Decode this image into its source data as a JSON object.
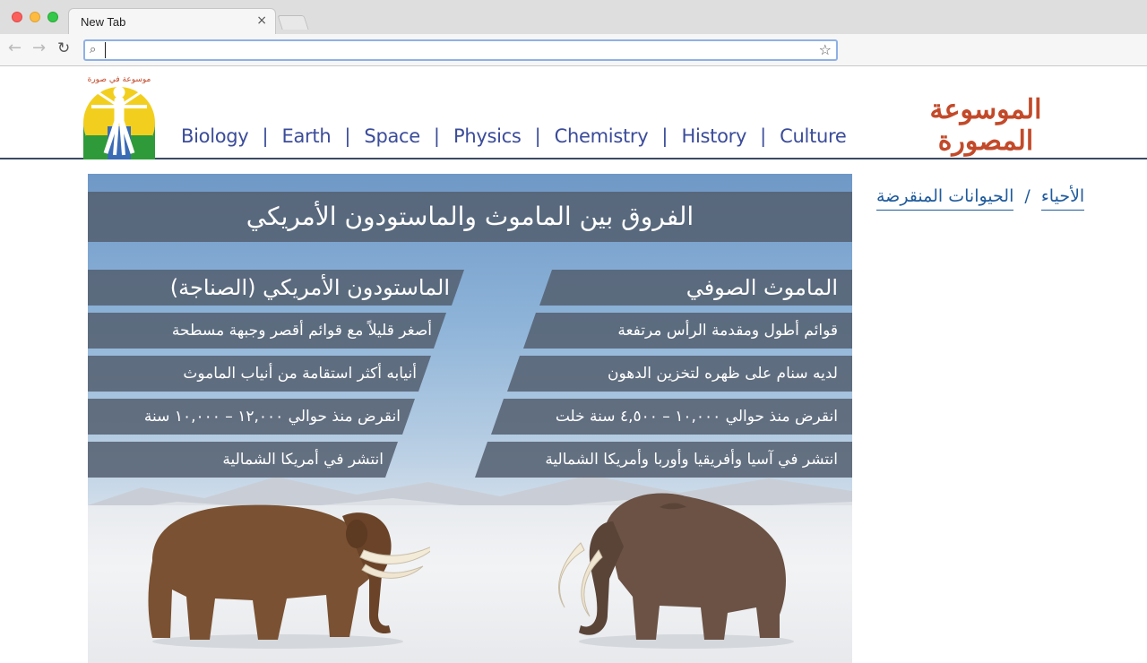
{
  "browser": {
    "tab_title": "New Tab",
    "tab_close": "×",
    "address_value": "",
    "nav_back": "←",
    "nav_forward": "→",
    "nav_reload": "↻",
    "search_glyph": "⌕",
    "star_glyph": "☆"
  },
  "site": {
    "title": "الموسوعة المصورة",
    "logo_icon": "vitruvian-man-logo",
    "logo_text": "موسوعة في صورة",
    "nav": [
      {
        "label": "Biology"
      },
      {
        "label": "Earth"
      },
      {
        "label": "Space"
      },
      {
        "label": "Physics"
      },
      {
        "label": "Chemistry"
      },
      {
        "label": "History"
      },
      {
        "label": "Culture"
      }
    ],
    "nav_separator": "|",
    "colors": {
      "nav": "#3b4c9a",
      "title": "#c24a2a",
      "breadcrumb": "#1f5b9c",
      "header_rule": "#3a4a63"
    }
  },
  "breadcrumb": {
    "items": [
      {
        "label": "الأحياء"
      },
      {
        "label": "الحيوانات المنقرضة"
      }
    ],
    "separator": "/"
  },
  "infographic": {
    "title": "الفروق بين الماموث والماستودون الأمريكي",
    "mammoth": {
      "heading": "الماموث الصوفي",
      "facts": [
        "قوائم أطول ومقدمة الرأس مرتفعة",
        "لديه سنام على ظهره لتخزين الدهون",
        "انقرض منذ حوالي ١٠,٠٠٠ – ٤,٥٠٠ سنة خلت",
        "انتشر في آسيا وأفريقيا وأوربا وأمريكا الشمالية"
      ]
    },
    "mastodon": {
      "heading": "الماستودون الأمريكي (الصناجة)",
      "facts": [
        "أصغر قليلاً مع قوائم أقصر وجبهة مسطحة",
        "أنيابه أكثر استقامة من أنياب الماموث",
        "انقرض منذ حوالي ١٢,٠٠٠ – ١٠,٠٠٠ سنة",
        "انتشر في أمريكا الشمالية"
      ]
    },
    "colors": {
      "banner": "#545f70",
      "mastodon_fur": "#7a5132",
      "mammoth_fur": "#6b5245",
      "tusk": "#f3ead8"
    }
  }
}
